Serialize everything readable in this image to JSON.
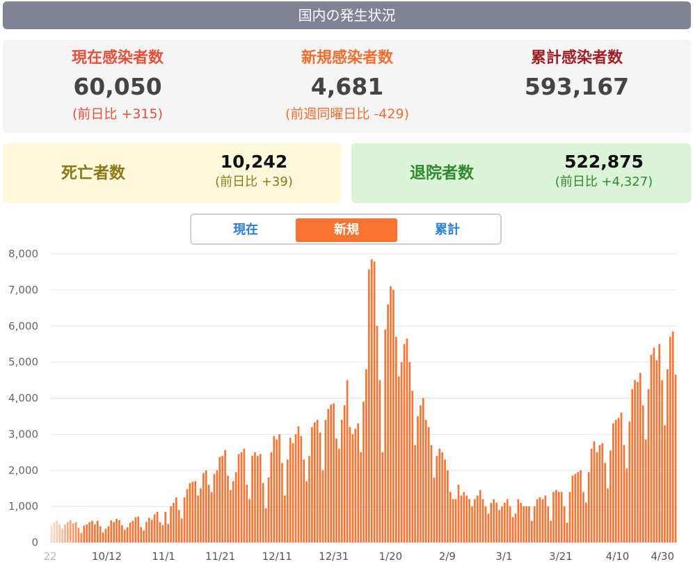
{
  "header": {
    "title": "国内の発生状況"
  },
  "summary": {
    "current": {
      "label": "現在感染者数",
      "value": "60,050",
      "diff": "(前日比 +315)",
      "color": "#e4503a"
    },
    "new": {
      "label": "新規感染者数",
      "value": "4,681",
      "diff": "(前週同曜日比 -429)",
      "color": "#f26e30"
    },
    "total": {
      "label": "累計感染者数",
      "value": "593,167",
      "color": "#a11d23"
    }
  },
  "deaths": {
    "label": "死亡者数",
    "value": "10,242",
    "diff": "(前日比 +39)",
    "color": "#8a7a15"
  },
  "discharged": {
    "label": "退院者数",
    "value": "522,875",
    "diff": "(前日比 +4,327)",
    "color": "#2f8a2f"
  },
  "tabs": [
    {
      "label": "現在",
      "active": false
    },
    {
      "label": "新規",
      "active": true
    },
    {
      "label": "累計",
      "active": false
    }
  ],
  "chart_data": {
    "type": "bar",
    "color": "#f97332",
    "ylim": [
      0,
      8000
    ],
    "yticks": [
      "0",
      "1,000",
      "2,000",
      "3,000",
      "4,000",
      "5,000",
      "6,000",
      "7,000",
      "8,000"
    ],
    "xtick_labels": [
      "22",
      "10/12",
      "11/1",
      "11/21",
      "12/11",
      "12/31",
      "1/20",
      "2/9",
      "3/1",
      "3/21",
      "4/10",
      "4/30"
    ],
    "grid": true,
    "values": [
      480,
      550,
      600,
      500,
      380,
      500,
      560,
      610,
      520,
      560,
      400,
      260,
      470,
      500,
      560,
      600,
      500,
      600,
      450,
      280,
      380,
      450,
      610,
      560,
      660,
      620,
      480,
      350,
      420,
      550,
      600,
      700,
      720,
      430,
      330,
      570,
      680,
      630,
      780,
      850,
      560,
      480,
      850,
      510,
      1000,
      1100,
      1250,
      900,
      660,
      1250,
      1480,
      1640,
      1680,
      1700,
      1300,
      1500,
      1920,
      2000,
      1600,
      1400,
      1900,
      2000,
      2370,
      2400,
      2560,
      1850,
      1450,
      1700,
      1950,
      2450,
      2500,
      2600,
      1600,
      1200,
      2400,
      2500,
      2400,
      2450,
      1650,
      950,
      1800,
      2500,
      2950,
      2850,
      3000,
      2200,
      1300,
      2300,
      2900,
      2750,
      3000,
      3220,
      2950,
      2300,
      1700,
      2400,
      3200,
      3330,
      3400,
      3050,
      2000,
      3400,
      3700,
      3820,
      3850,
      2880,
      2600,
      3400,
      3800,
      4500,
      3200,
      3000,
      3150,
      3300,
      2500,
      3900,
      4800,
      7570,
      7850,
      7790,
      6000,
      4500,
      2500,
      5900,
      6600,
      7100,
      7000,
      5700,
      4600,
      5000,
      5500,
      5650,
      5000,
      4200,
      2700,
      3500,
      3800,
      4000,
      3400,
      3200,
      2700,
      1800,
      2400,
      2600,
      2500,
      2300,
      2000,
      1400,
      1200,
      1200,
      1600,
      1300,
      1400,
      1300,
      1200,
      1000,
      1200,
      1300,
      1450,
      1200,
      1000,
      800,
      1100,
      1200,
      1100,
      900,
      1000,
      1100,
      1200,
      1000,
      700,
      800,
      1200,
      1100,
      1000,
      1000,
      1000,
      600,
      1000,
      1200,
      1250,
      1200,
      1300,
      1000,
      600,
      1400,
      1450,
      1400,
      1400,
      1000,
      550,
      1400,
      1850,
      1900,
      1950,
      2000,
      1400,
      1100,
      1950,
      2600,
      2800,
      2500,
      2700,
      2750,
      2200,
      1500,
      2550,
      3300,
      3400,
      3450,
      3600,
      2700,
      2050,
      3350,
      4250,
      4500,
      4450,
      4700,
      3800,
      2850,
      4250,
      5200,
      5400,
      5050,
      5500,
      4500,
      3250,
      4800,
      5700,
      5850,
      4650
    ]
  }
}
